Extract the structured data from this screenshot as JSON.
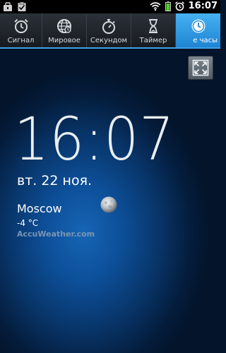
{
  "status_bar": {
    "time": "16:07"
  },
  "tabs": [
    {
      "label": "Сигнал",
      "icon": "alarm-clock-icon"
    },
    {
      "label": "Мировое",
      "icon": "globe-icon"
    },
    {
      "label": "Секундом",
      "icon": "stopwatch-icon"
    },
    {
      "label": "Таймер",
      "icon": "hourglass-icon"
    },
    {
      "label": "е часы",
      "icon": "clock-icon",
      "active": true
    }
  ],
  "clock": {
    "time": "16:07",
    "date": "вт. 22 ноя."
  },
  "weather": {
    "city": "Moscow",
    "temperature": "-4 °C",
    "provider": "AccuWeather.com",
    "icon": "moon-icon"
  },
  "colors": {
    "accent": "#3ea0e4",
    "active_tab": "#2d96de"
  }
}
